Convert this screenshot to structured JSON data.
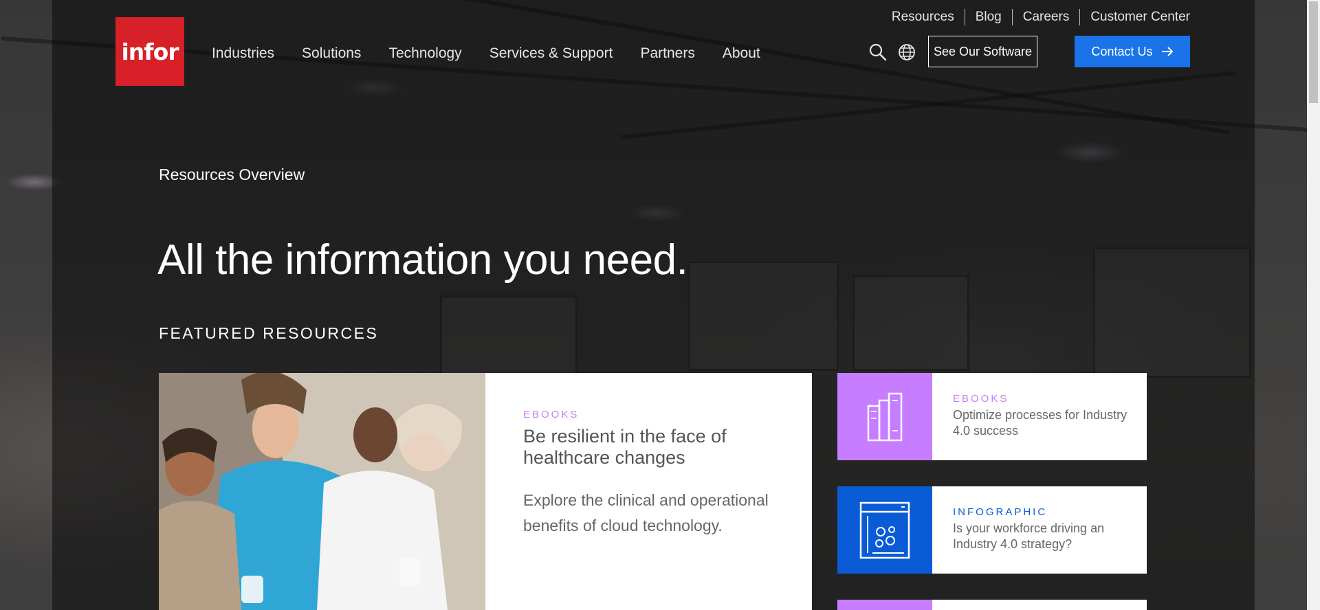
{
  "header": {
    "logo_text": "infor",
    "main_nav": [
      "Industries",
      "Solutions",
      "Technology",
      "Services & Support",
      "Partners",
      "About"
    ],
    "utility_nav": [
      "Resources",
      "Blog",
      "Careers",
      "Customer Center"
    ],
    "see_software_label": "See Our Software",
    "contact_label": "Contact Us"
  },
  "hero": {
    "overview_label": "Resources Overview",
    "title": "All the information you need.",
    "featured_heading": "FEATURED RESOURCES"
  },
  "featured": {
    "main": {
      "type": "EBOOKS",
      "title": "Be resilient in the face of healthcare changes",
      "description": "Explore the clinical and operational benefits of cloud technology."
    },
    "side": [
      {
        "type": "EBOOKS",
        "title": "Optimize processes for Industry 4.0 success",
        "icon": "books-icon"
      },
      {
        "type": "INFOGRAPHIC",
        "title": "Is your workforce driving an Industry 4.0 strategy?",
        "icon": "browser-gears-icon"
      }
    ]
  },
  "colors": {
    "brand_red": "#d72027",
    "contact_blue": "#1a73e8",
    "ebook_purple": "#c77dff",
    "infographic_blue": "#0a5bd6"
  }
}
